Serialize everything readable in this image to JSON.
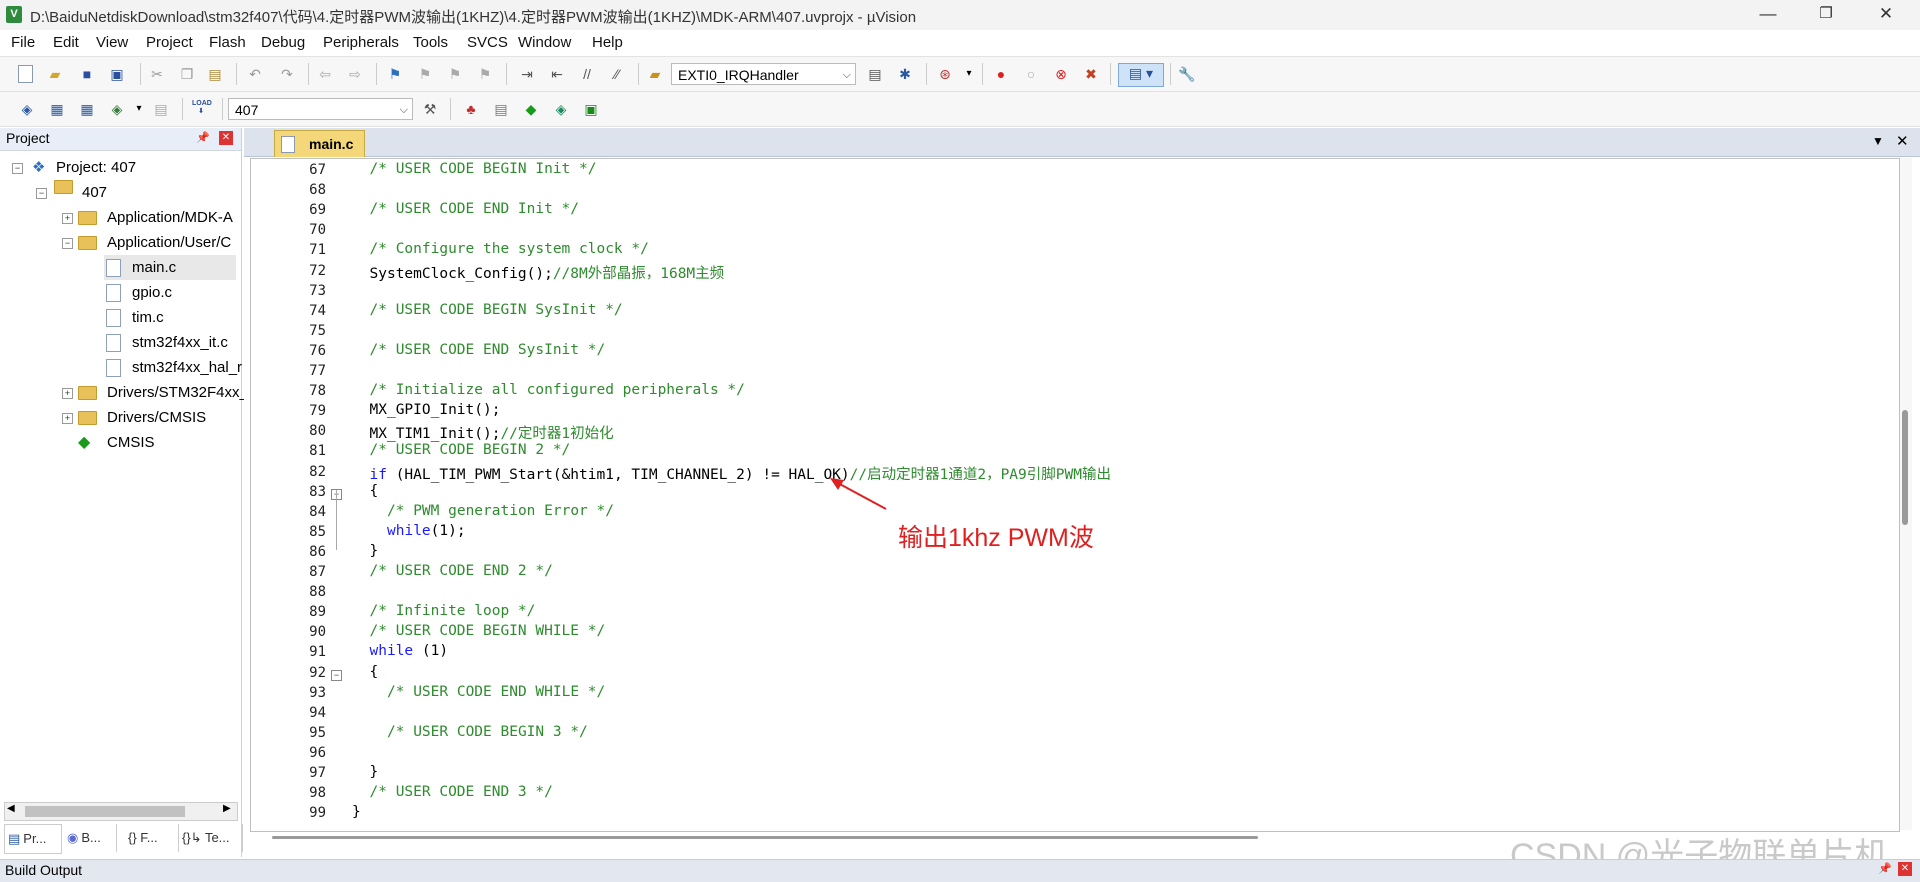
{
  "window": {
    "title": "D:\\BaiduNetdiskDownload\\stm32f407\\代码\\4.定时器PWM波输出(1KHZ)\\4.定时器PWM波输出(1KHZ)\\MDK-ARM\\407.uvprojx - µVision",
    "controls": [
      "—",
      "❐",
      "✕"
    ]
  },
  "menu": [
    "File",
    "Edit",
    "View",
    "Project",
    "Flash",
    "Debug",
    "Peripherals",
    "Tools",
    "SVCS",
    "Window",
    "Help"
  ],
  "toolbar1": {
    "function_combo": "EXTI0_IRQHandler"
  },
  "toolbar2": {
    "load_label": "LOAD",
    "target_combo": "407"
  },
  "project_panel": {
    "header": "Project",
    "pin": "📌",
    "close": "✕",
    "tree": [
      {
        "label": "Project: 407",
        "expander": "−"
      },
      {
        "label": "407",
        "expander": "−"
      },
      {
        "label": "Application/MDK-A",
        "expander": "+"
      },
      {
        "label": "Application/User/C",
        "expander": "−"
      },
      {
        "label": "main.c"
      },
      {
        "label": "gpio.c"
      },
      {
        "label": "tim.c"
      },
      {
        "label": "stm32f4xx_it.c"
      },
      {
        "label": "stm32f4xx_hal_r"
      },
      {
        "label": "Drivers/STM32F4xx_",
        "expander": "+"
      },
      {
        "label": "Drivers/CMSIS",
        "expander": "+"
      },
      {
        "label": "CMSIS"
      }
    ],
    "bottom_tabs": [
      "Pr...",
      "B...",
      "{} F...",
      "{}↳ Te..."
    ]
  },
  "editor": {
    "tab": "main.c",
    "tab_menu": "▼",
    "tab_close": "✕",
    "lines": [
      {
        "n": "67",
        "text": "/* USER CODE BEGIN Init */",
        "cls": "cm",
        "indent": 2
      },
      {
        "n": "68",
        "text": "",
        "cls": "",
        "indent": 0
      },
      {
        "n": "69",
        "text": "/* USER CODE END Init */",
        "cls": "cm",
        "indent": 2
      },
      {
        "n": "70",
        "text": "",
        "cls": "",
        "indent": 0
      },
      {
        "n": "71",
        "text": "/* Configure the system clock */",
        "cls": "cm",
        "indent": 2
      },
      {
        "n": "72",
        "text": "SystemClock_Config();",
        "cls": "",
        "indent": 2,
        "comment": "//8M外部晶振，168M主频"
      },
      {
        "n": "73",
        "text": "",
        "cls": "",
        "indent": 0
      },
      {
        "n": "74",
        "text": "/* USER CODE BEGIN SysInit */",
        "cls": "cm",
        "indent": 2
      },
      {
        "n": "75",
        "text": "",
        "cls": "",
        "indent": 0
      },
      {
        "n": "76",
        "text": "/* USER CODE END SysInit */",
        "cls": "cm",
        "indent": 2
      },
      {
        "n": "77",
        "text": "",
        "cls": "",
        "indent": 0
      },
      {
        "n": "78",
        "text": "/* Initialize all configured peripherals */",
        "cls": "cm",
        "indent": 2
      },
      {
        "n": "79",
        "text": "MX_GPIO_Init();",
        "cls": "",
        "indent": 2
      },
      {
        "n": "80",
        "text": "MX_TIM1_Init();",
        "cls": "",
        "indent": 2,
        "comment": "//定时器1初始化"
      },
      {
        "n": "81",
        "text": "/* USER CODE BEGIN 2 */",
        "cls": "cm",
        "indent": 2
      },
      {
        "n": "82",
        "keyword": "if",
        "text": " (HAL_TIM_PWM_Start(&htim1, TIM_CHANNEL_2) != HAL_OK)",
        "cls": "",
        "indent": 2,
        "comment": "//启动定时器1通道2，PA9引脚PWM输出"
      },
      {
        "n": "83",
        "text": "{",
        "cls": "",
        "indent": 2,
        "fold": "−"
      },
      {
        "n": "84",
        "text": "/* PWM generation Error */",
        "cls": "cm",
        "indent": 4
      },
      {
        "n": "85",
        "keyword": "while",
        "text": "(1);",
        "cls": "",
        "indent": 4
      },
      {
        "n": "86",
        "text": "}",
        "cls": "",
        "indent": 2
      },
      {
        "n": "87",
        "text": "/* USER CODE END 2 */",
        "cls": "cm",
        "indent": 2
      },
      {
        "n": "88",
        "text": "",
        "cls": "",
        "indent": 0
      },
      {
        "n": "89",
        "text": "/* Infinite loop */",
        "cls": "cm",
        "indent": 2
      },
      {
        "n": "90",
        "text": "/* USER CODE BEGIN WHILE */",
        "cls": "cm",
        "indent": 2
      },
      {
        "n": "91",
        "keyword": "while",
        "text": " (1)",
        "cls": "",
        "indent": 2
      },
      {
        "n": "92",
        "text": "{",
        "cls": "",
        "indent": 2,
        "fold": "−"
      },
      {
        "n": "93",
        "text": "/* USER CODE END WHILE */",
        "cls": "cm",
        "indent": 4
      },
      {
        "n": "94",
        "text": "",
        "cls": "",
        "indent": 0
      },
      {
        "n": "95",
        "text": "/* USER CODE BEGIN 3 */",
        "cls": "cm",
        "indent": 4
      },
      {
        "n": "96",
        "text": "",
        "cls": "",
        "indent": 0
      },
      {
        "n": "97",
        "text": "}",
        "cls": "",
        "indent": 2
      },
      {
        "n": "98",
        "text": "/* USER CODE END 3 */",
        "cls": "cm",
        "indent": 2
      },
      {
        "n": "99",
        "text": "}",
        "cls": "",
        "indent": 0
      }
    ]
  },
  "annotation": "输出1khz PWM波",
  "build_output": {
    "title": "Build Output",
    "pin": "📌",
    "close": "✕"
  },
  "watermark": "CSDN @光子物联单片机",
  "colors": {
    "comment": "#2e8b2e",
    "keyword": "#1a1aff",
    "annotation": "#e02020",
    "tab_active": "#f3d779"
  }
}
